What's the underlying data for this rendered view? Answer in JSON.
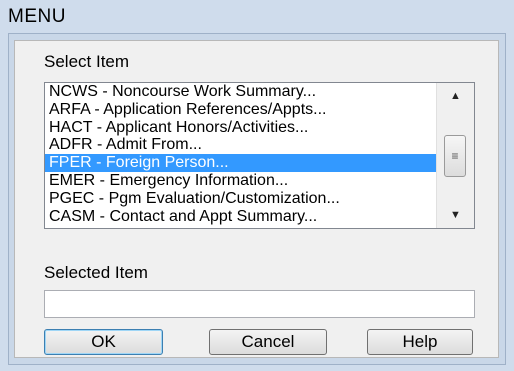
{
  "window": {
    "title": "MENU"
  },
  "select_section": {
    "label": "Select Item"
  },
  "list": {
    "items": [
      "NCWS - Noncourse Work Summary...",
      "ARFA - Application References/Appts...",
      "HACT - Applicant Honors/Activities...",
      "ADFR - Admit From...",
      "FPER - Foreign Person...",
      "EMER - Emergency Information...",
      "PGEC - Pgm Evaluation/Customization...",
      "CASM - Contact and Appt Summary..."
    ],
    "selected_index": 4,
    "scrollbar": {
      "up_icon": "▲",
      "down_icon": "▼",
      "thumb_icon": "≡"
    }
  },
  "selected_section": {
    "label": "Selected Item",
    "value": ""
  },
  "buttons": {
    "ok": "OK",
    "cancel": "Cancel",
    "help": "Help"
  },
  "colors": {
    "selection": "#3399ff",
    "background": "#cfdcec",
    "panel": "#f0f0f0"
  }
}
